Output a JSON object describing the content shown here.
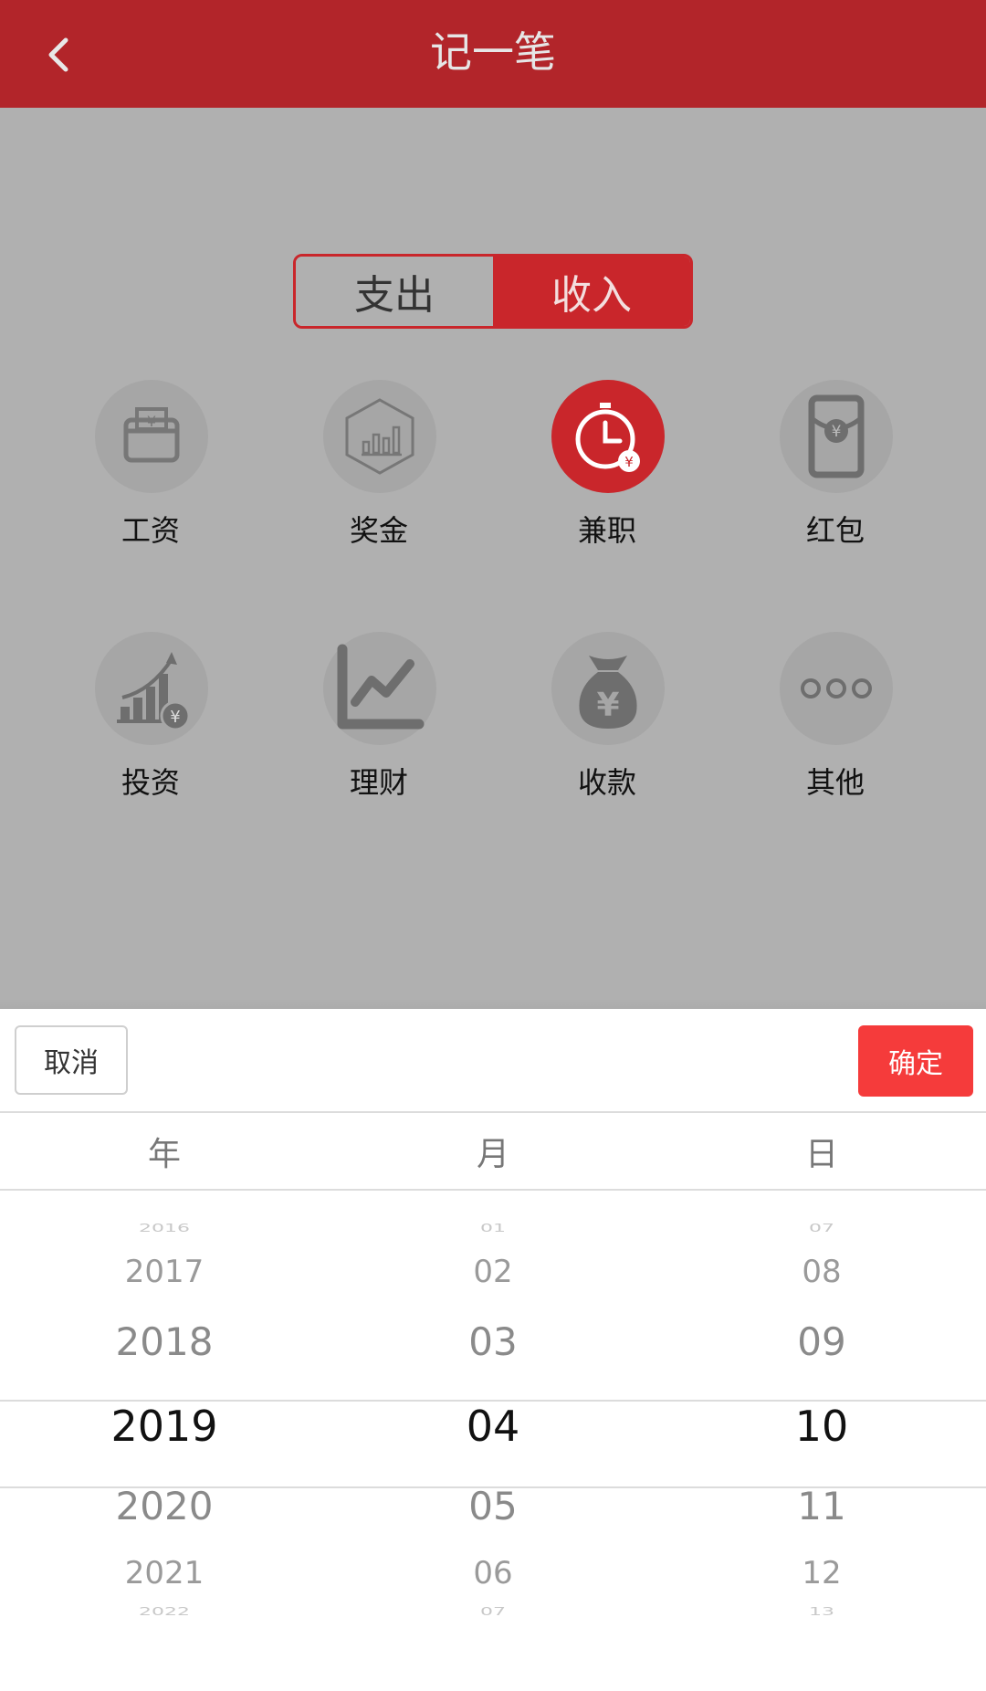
{
  "header": {
    "title": "记一笔",
    "back_icon": "chevron-left-icon"
  },
  "tabs": [
    {
      "label": "支出",
      "active": false
    },
    {
      "label": "收入",
      "active": true
    }
  ],
  "categories": [
    {
      "label": "工资",
      "icon": "wallet-yen-icon",
      "active": false
    },
    {
      "label": "奖金",
      "icon": "hexagon-bar-chart-icon",
      "active": false
    },
    {
      "label": "兼职",
      "icon": "clock-yen-icon",
      "active": true
    },
    {
      "label": "红包",
      "icon": "red-envelope-yen-icon",
      "active": false
    },
    {
      "label": "投资",
      "icon": "growth-chart-yen-icon",
      "active": false
    },
    {
      "label": "理财",
      "icon": "line-chart-icon",
      "active": false
    },
    {
      "label": "收款",
      "icon": "money-bag-yen-icon",
      "active": false
    },
    {
      "label": "其他",
      "icon": "three-dots-icon",
      "active": false
    }
  ],
  "picker": {
    "cancel_label": "取消",
    "ok_label": "确定",
    "columns": [
      {
        "header": "年",
        "options": [
          "2016",
          "2017",
          "2018",
          "2019",
          "2020",
          "2021",
          "2022"
        ],
        "selected": "2019"
      },
      {
        "header": "月",
        "options": [
          "01",
          "02",
          "03",
          "04",
          "05",
          "06",
          "07"
        ],
        "selected": "04"
      },
      {
        "header": "日",
        "options": [
          "07",
          "08",
          "09",
          "10",
          "11",
          "12",
          "13"
        ],
        "selected": "10"
      }
    ]
  },
  "colors": {
    "brand_red": "#b2252a",
    "accent_red": "#c9262b",
    "confirm_red": "#f53b3b",
    "overlay_gray": "#b0b0b0"
  }
}
